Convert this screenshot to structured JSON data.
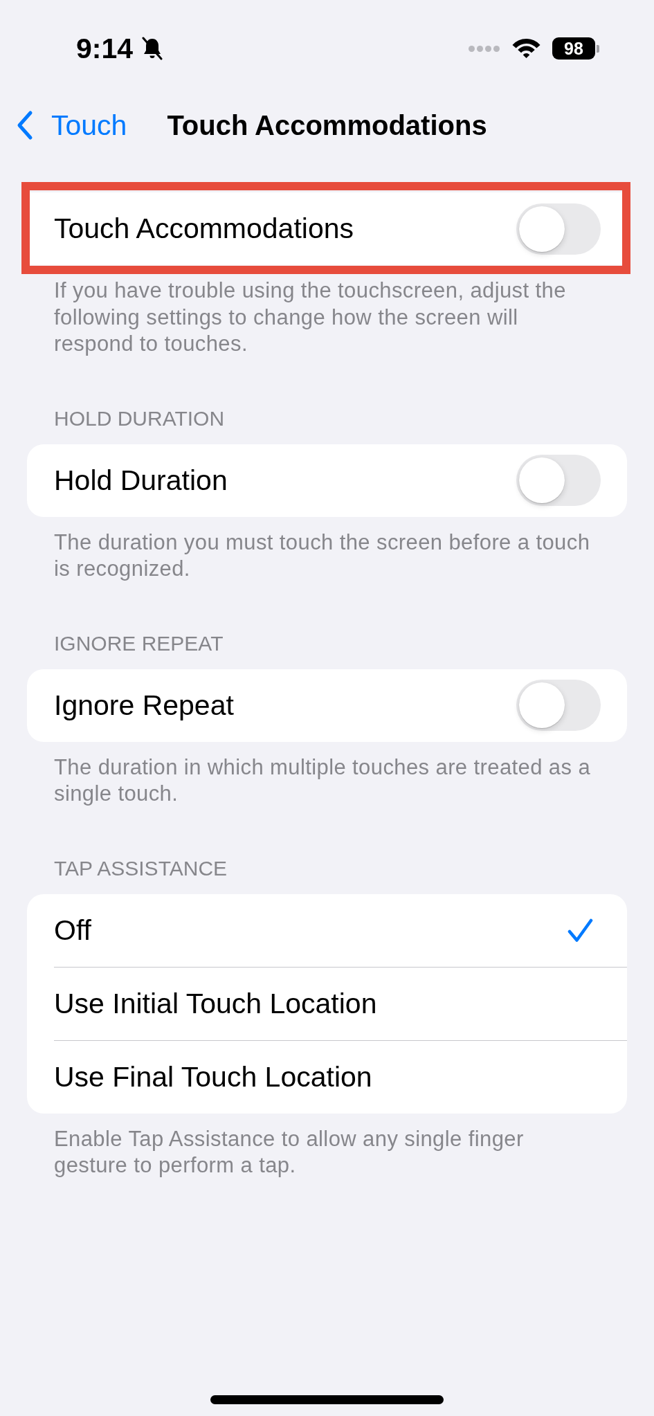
{
  "status_bar": {
    "time": "9:14",
    "battery": "98"
  },
  "nav": {
    "back_label": "Touch",
    "title": "Touch Accommodations"
  },
  "sections": [
    {
      "highlighted": true,
      "rows": [
        {
          "kind": "toggle",
          "label": "Touch Accommodations",
          "on": false
        }
      ],
      "footer": "If you have trouble using the touchscreen, adjust the following settings to change how the screen will respond to touches."
    },
    {
      "highlighted": false,
      "header": "HOLD DURATION",
      "rows": [
        {
          "kind": "toggle",
          "label": "Hold Duration",
          "on": false
        }
      ],
      "footer": "The duration you must touch the screen before a touch is recognized."
    },
    {
      "highlighted": false,
      "header": "IGNORE REPEAT",
      "rows": [
        {
          "kind": "toggle",
          "label": "Ignore Repeat",
          "on": false
        }
      ],
      "footer": "The duration in which multiple touches are treated as a single touch."
    },
    {
      "highlighted": false,
      "header": "TAP ASSISTANCE",
      "rows": [
        {
          "kind": "option",
          "label": "Off",
          "selected": true
        },
        {
          "kind": "option",
          "label": "Use Initial Touch Location",
          "selected": false
        },
        {
          "kind": "option",
          "label": "Use Final Touch Location",
          "selected": false
        }
      ],
      "footer": "Enable Tap Assistance to allow any single finger gesture to perform a tap."
    }
  ]
}
